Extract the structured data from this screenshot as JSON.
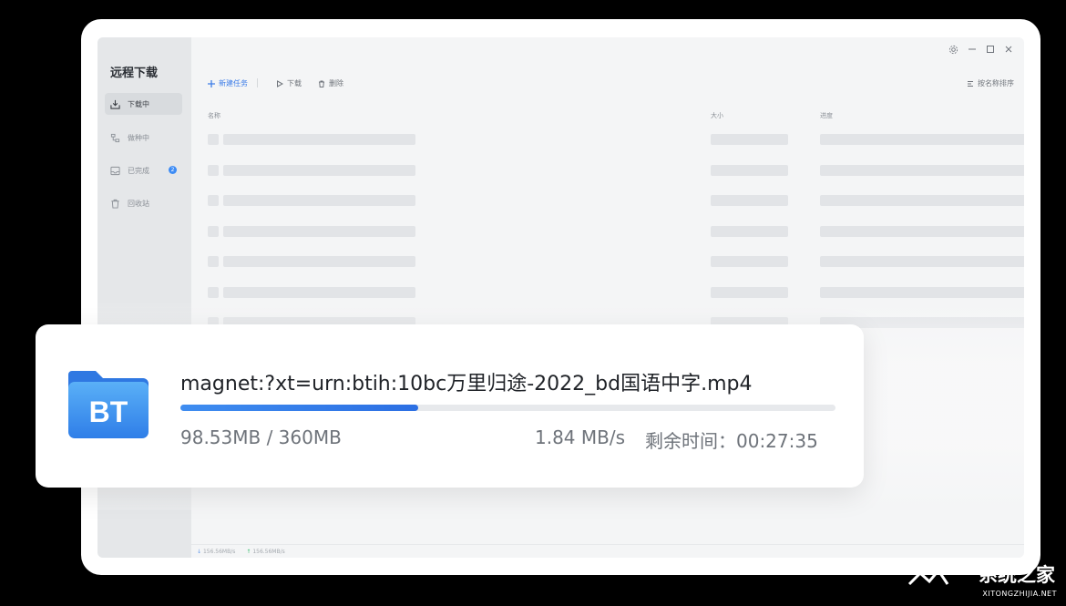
{
  "app": {
    "title": "远程下载",
    "nav": [
      {
        "label": "下载中",
        "icon": "download-tray-icon",
        "active": true
      },
      {
        "label": "做种中",
        "icon": "seed-icon",
        "active": false
      },
      {
        "label": "已完成",
        "icon": "completed-tray-icon",
        "active": false,
        "badge": "2"
      },
      {
        "label": "回收站",
        "icon": "trash-icon",
        "active": false
      }
    ],
    "toolbar": {
      "new_task": "新建任务",
      "download": "下载",
      "delete": "删除",
      "sort": "按名称排序"
    },
    "columns": {
      "name": "名称",
      "size": "大小",
      "progress": "进度"
    },
    "status": {
      "down_speed": "156.56MB/s",
      "up_speed": "156.56MB/s"
    }
  },
  "card": {
    "file_name": "magnet:?xt=urn:btih:10bc万里归途-2022_bd国语中字.mp4",
    "icon_label": "BT",
    "progress_fraction": 0.3626,
    "size": "98.53MB / 360MB",
    "speed": "1.84 MB/s",
    "remaining": "剩余时间：00:27:35"
  },
  "watermark": {
    "text": "系统之家",
    "sub": "XITONGZHIJIA.NET"
  },
  "colors": {
    "accent": "#3d7de8",
    "folder_light": "#5aaaf5",
    "folder_dark": "#2f7ee8"
  }
}
